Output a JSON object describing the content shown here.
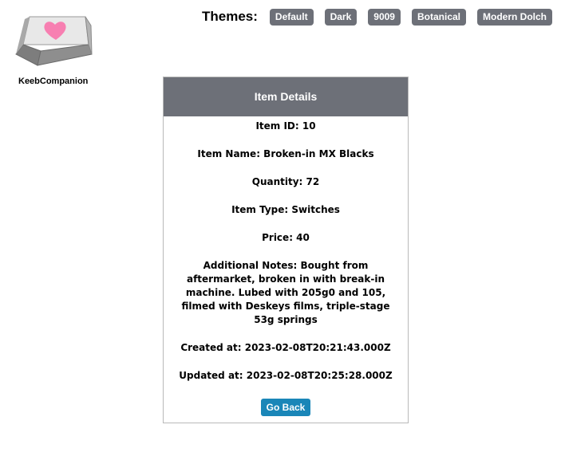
{
  "brand": {
    "name": "KeebCompanion",
    "logo_icon": "keycap-heart-icon",
    "heart_color": "#f77fb1"
  },
  "themes": {
    "label": "Themes:",
    "options": [
      "Default",
      "Dark",
      "9009",
      "Botanical",
      "Modern Dolch"
    ]
  },
  "card": {
    "title": "Item Details",
    "fields": {
      "item_id": "Item ID: 10",
      "item_name": "Item Name: Broken-in MX Blacks",
      "quantity": "Quantity: 72",
      "item_type": "Item Type: Switches",
      "price": "Price: 40",
      "notes": "Additional Notes: Bought from aftermarket, broken in with break-in machine. Lubed with 205g0 and 105, filmed with Deskeys films, triple-stage 53g springs",
      "created_at": "Created at: 2023-02-08T20:21:43.000Z",
      "updated_at": "Updated at: 2023-02-08T20:25:28.000Z"
    },
    "back_label": "Go Back"
  },
  "colors": {
    "header_bg": "#6d7078",
    "theme_button_bg": "#6d7078",
    "back_button_bg": "#1a86b8"
  }
}
